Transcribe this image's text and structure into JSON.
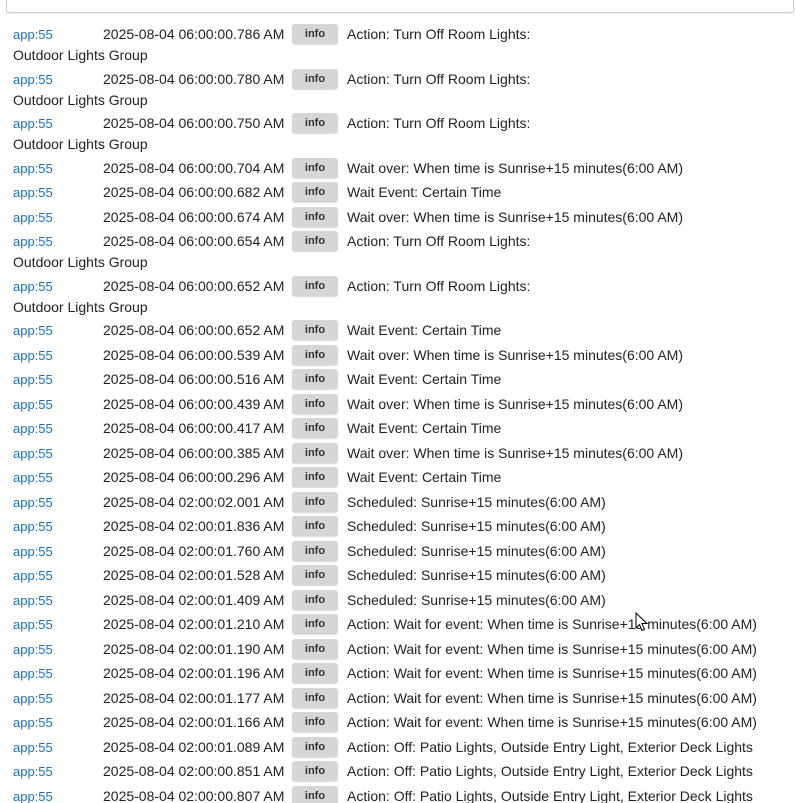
{
  "log": {
    "level_label": "info",
    "entries": [
      {
        "app": "app:55",
        "time": "2025-08-04 06:00:00.786 AM",
        "msg": "Action: Turn Off Room Lights:",
        "msg2": "Outdoor Lights Group"
      },
      {
        "app": "app:55",
        "time": "2025-08-04 06:00:00.780 AM",
        "msg": "Action: Turn Off Room Lights:",
        "msg2": "Outdoor Lights Group"
      },
      {
        "app": "app:55",
        "time": "2025-08-04 06:00:00.750 AM",
        "msg": "Action: Turn Off Room Lights:",
        "msg2": "Outdoor Lights Group"
      },
      {
        "app": "app:55",
        "time": "2025-08-04 06:00:00.704 AM",
        "msg": "Wait over: When time is Sunrise+15 minutes(6:00 AM)"
      },
      {
        "app": "app:55",
        "time": "2025-08-04 06:00:00.682 AM",
        "msg": "Wait Event: Certain Time"
      },
      {
        "app": "app:55",
        "time": "2025-08-04 06:00:00.674 AM",
        "msg": "Wait over: When time is Sunrise+15 minutes(6:00 AM)"
      },
      {
        "app": "app:55",
        "time": "2025-08-04 06:00:00.654 AM",
        "msg": "Action: Turn Off Room Lights:",
        "msg2": "Outdoor Lights Group"
      },
      {
        "app": "app:55",
        "time": "2025-08-04 06:00:00.652 AM",
        "msg": "Action: Turn Off Room Lights:",
        "msg2": "Outdoor Lights Group"
      },
      {
        "app": "app:55",
        "time": "2025-08-04 06:00:00.652 AM",
        "msg": "Wait Event: Certain Time"
      },
      {
        "app": "app:55",
        "time": "2025-08-04 06:00:00.539 AM",
        "msg": "Wait over: When time is Sunrise+15 minutes(6:00 AM)"
      },
      {
        "app": "app:55",
        "time": "2025-08-04 06:00:00.516 AM",
        "msg": "Wait Event: Certain Time"
      },
      {
        "app": "app:55",
        "time": "2025-08-04 06:00:00.439 AM",
        "msg": "Wait over: When time is Sunrise+15 minutes(6:00 AM)"
      },
      {
        "app": "app:55",
        "time": "2025-08-04 06:00:00.417 AM",
        "msg": "Wait Event: Certain Time"
      },
      {
        "app": "app:55",
        "time": "2025-08-04 06:00:00.385 AM",
        "msg": "Wait over: When time is Sunrise+15 minutes(6:00 AM)"
      },
      {
        "app": "app:55",
        "time": "2025-08-04 06:00:00.296 AM",
        "msg": "Wait Event: Certain Time"
      },
      {
        "app": "app:55",
        "time": "2025-08-04 02:00:02.001 AM",
        "msg": "Scheduled: Sunrise+15 minutes(6:00 AM)"
      },
      {
        "app": "app:55",
        "time": "2025-08-04 02:00:01.836 AM",
        "msg": "Scheduled: Sunrise+15 minutes(6:00 AM)"
      },
      {
        "app": "app:55",
        "time": "2025-08-04 02:00:01.760 AM",
        "msg": "Scheduled: Sunrise+15 minutes(6:00 AM)"
      },
      {
        "app": "app:55",
        "time": "2025-08-04 02:00:01.528 AM",
        "msg": "Scheduled: Sunrise+15 minutes(6:00 AM)"
      },
      {
        "app": "app:55",
        "time": "2025-08-04 02:00:01.409 AM",
        "msg": "Scheduled: Sunrise+15 minutes(6:00 AM)"
      },
      {
        "app": "app:55",
        "time": "2025-08-04 02:00:01.210 AM",
        "msg": "Action: Wait for event: When time is Sunrise+15 minutes(6:00 AM)"
      },
      {
        "app": "app:55",
        "time": "2025-08-04 02:00:01.190 AM",
        "msg": "Action: Wait for event: When time is Sunrise+15 minutes(6:00 AM)"
      },
      {
        "app": "app:55",
        "time": "2025-08-04 02:00:01.196 AM",
        "msg": "Action: Wait for event: When time is Sunrise+15 minutes(6:00 AM)"
      },
      {
        "app": "app:55",
        "time": "2025-08-04 02:00:01.177 AM",
        "msg": "Action: Wait for event: When time is Sunrise+15 minutes(6:00 AM)"
      },
      {
        "app": "app:55",
        "time": "2025-08-04 02:00:01.166 AM",
        "msg": "Action: Wait for event: When time is Sunrise+15 minutes(6:00 AM)"
      },
      {
        "app": "app:55",
        "time": "2025-08-04 02:00:01.089 AM",
        "msg": "Action: Off: Patio Lights, Outside Entry Light, Exterior Deck Lights"
      },
      {
        "app": "app:55",
        "time": "2025-08-04 02:00:00.851 AM",
        "msg": "Action: Off: Patio Lights, Outside Entry Light, Exterior Deck Lights"
      },
      {
        "app": "app:55",
        "time": "2025-08-04 02:00:00.807 AM",
        "msg": "Action: Off: Patio Lights, Outside Entry Light, Exterior Deck Lights"
      }
    ]
  },
  "colors": {
    "app_link": "#1a73b8",
    "level_badge_bg": "#d6d6d6",
    "text": "#222222"
  }
}
